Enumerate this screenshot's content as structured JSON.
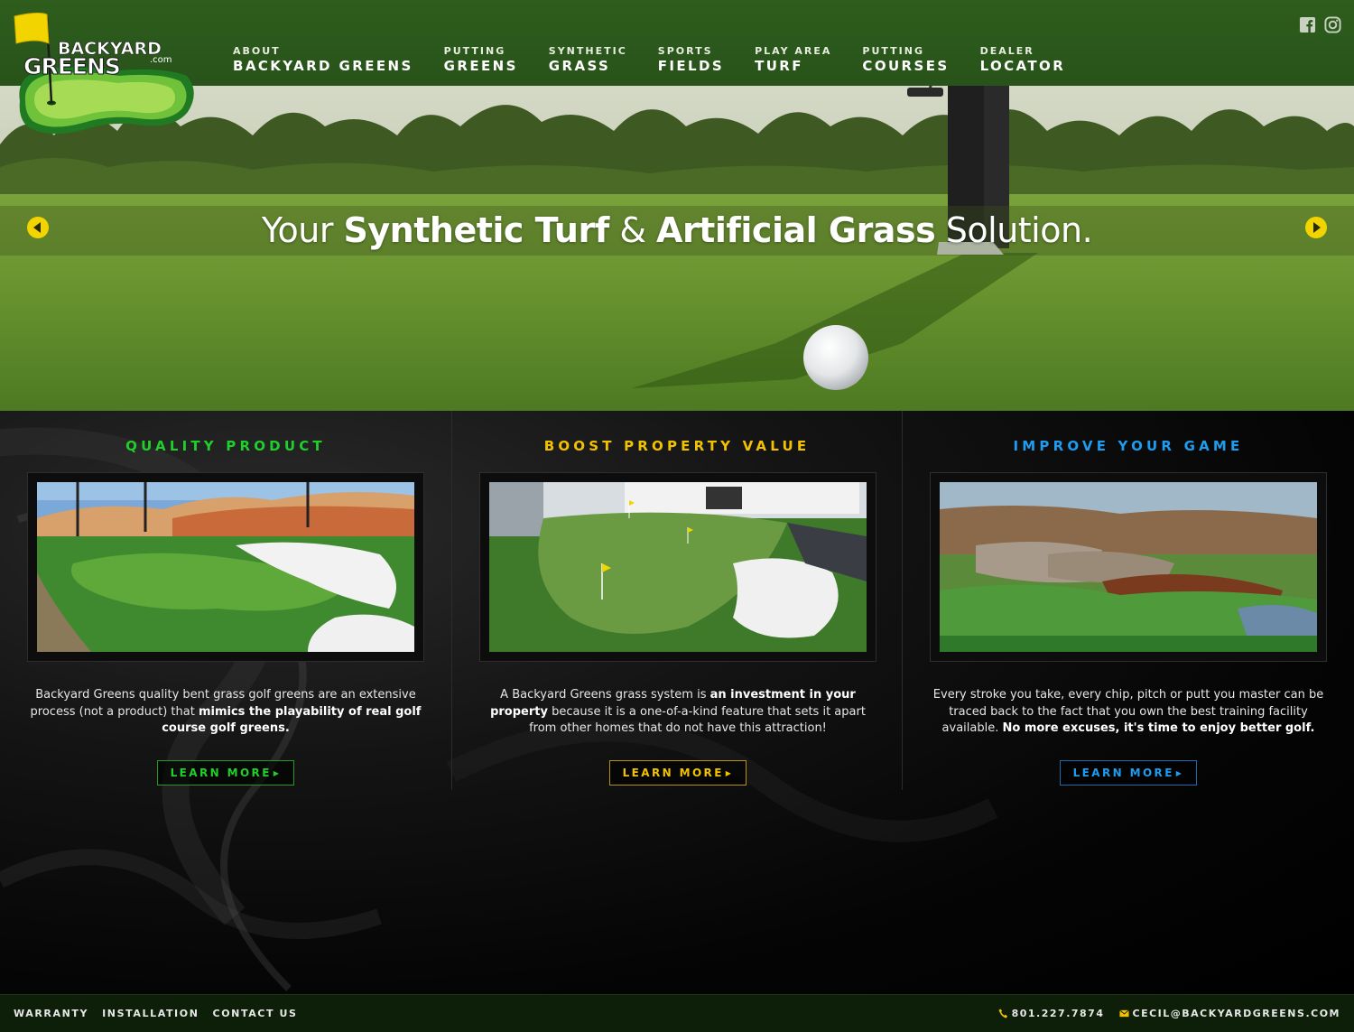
{
  "brand": {
    "logo_line1": "BACKYARD",
    "logo_line2": "GREENS",
    "logo_suffix": ".com",
    "colors": {
      "header_green": "#2e5d1d",
      "flag_yellow": "#f2d500",
      "green_title": "#1fd02a",
      "yellow_title": "#f2c200",
      "blue_title": "#1e9cf0"
    }
  },
  "nav": {
    "items": [
      {
        "small": "ABOUT",
        "big": "BACKYARD GREENS"
      },
      {
        "small": "PUTTING",
        "big": "GREENS"
      },
      {
        "small": "SYNTHETIC",
        "big": "GRASS"
      },
      {
        "small": "SPORTS",
        "big": "FIELDS"
      },
      {
        "small": "PLAY AREA",
        "big": "TURF"
      },
      {
        "small": "PUTTING",
        "big": "COURSES"
      },
      {
        "small": "DEALER",
        "big": "LOCATOR"
      }
    ]
  },
  "social": {
    "icons": [
      "facebook-icon",
      "instagram-icon"
    ]
  },
  "hero": {
    "part1": "Your ",
    "part2": "Synthetic Turf",
    "part3": " & ",
    "part4": "Artificial Grass",
    "part5": " Solution."
  },
  "columns": [
    {
      "title": "QUALITY PRODUCT",
      "color": "#1fd02a",
      "desc_plain1": "Backyard Greens quality bent grass golf greens are an extensive process (not a product) that ",
      "desc_bold1": "mimics the playability of real golf course golf greens.",
      "desc_plain2": "",
      "button": "LEARN MORE"
    },
    {
      "title": "BOOST PROPERTY VALUE",
      "color": "#f2c200",
      "desc_plain1": "A Backyard Greens grass system is ",
      "desc_bold1": "an investment in your property",
      "desc_plain2": " because it is a one-of-a-kind feature that sets it apart from other homes that do not have this attraction!",
      "button": "LEARN MORE"
    },
    {
      "title": "IMPROVE YOUR GAME",
      "color": "#1e9cf0",
      "desc_plain1": "Every stroke you take, every chip, pitch or putt you master can be traced back to the fact that you own the best training facility available. ",
      "desc_bold1": "No more excuses, it's time to enjoy better golf.",
      "desc_plain2": "",
      "button": "LEARN MORE"
    }
  ],
  "footer": {
    "links": [
      "WARRANTY",
      "INSTALLATION",
      "CONTACT US"
    ],
    "phone": "801.227.7874",
    "email": "CECIL@BACKYARDGREENS.COM"
  }
}
